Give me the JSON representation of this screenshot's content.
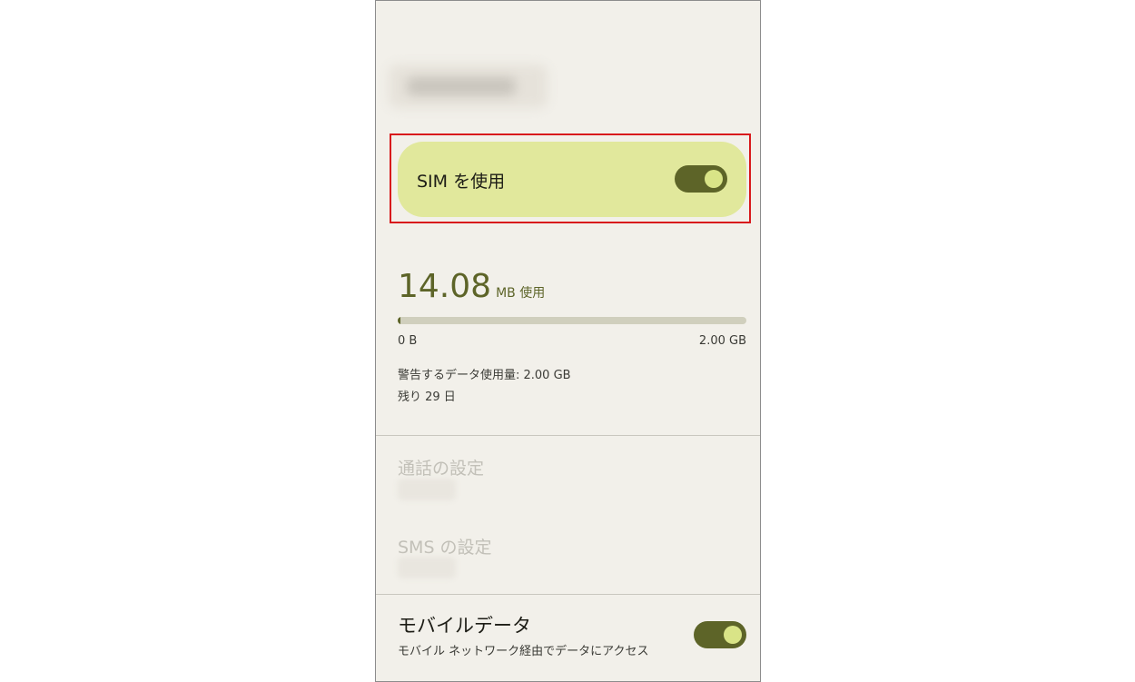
{
  "sim": {
    "label": "SIM を使用",
    "enabled": true
  },
  "usage": {
    "value": "14.08",
    "unit": "MB 使用",
    "progress_fraction": 0.007,
    "min_label": "0 B",
    "max_label": "2.00 GB",
    "warning": "警告するデータ使用量: 2.00 GB",
    "remaining": "残り 29 日"
  },
  "call_settings": {
    "title": "通話の設定"
  },
  "sms_settings": {
    "title": "SMS の設定"
  },
  "mobile_data": {
    "title": "モバイルデータ",
    "subtitle": "モバイル ネットワーク経由でデータにアクセス",
    "enabled": true
  },
  "colors": {
    "accent": "#5d6428",
    "card": "#e1e89c",
    "highlight": "#d8191c",
    "background": "#f2f0ea"
  }
}
